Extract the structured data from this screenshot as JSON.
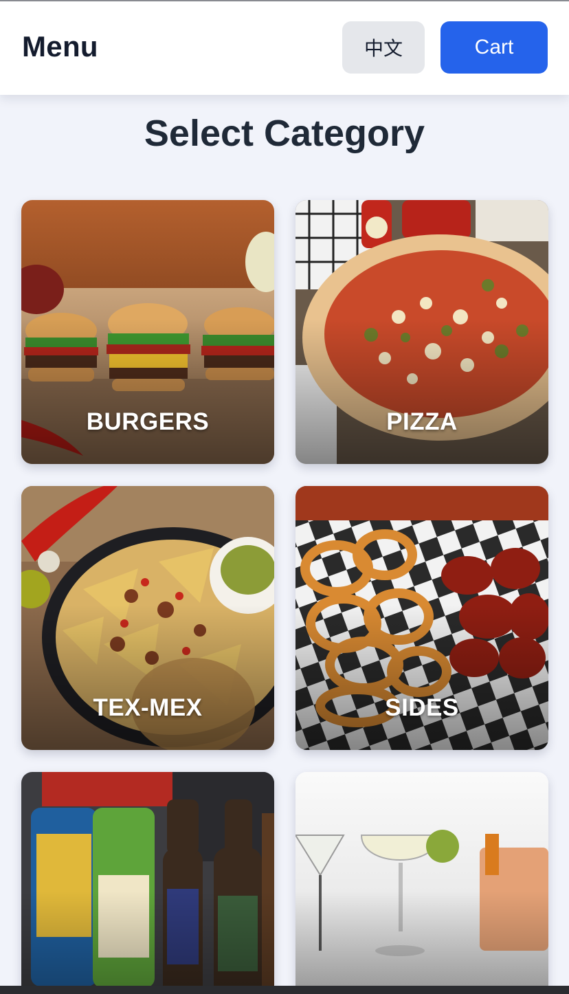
{
  "header": {
    "title": "Menu",
    "language_label": "中文",
    "cart_label": "Cart"
  },
  "main": {
    "heading": "Select Category",
    "categories": [
      {
        "label": "BURGERS",
        "icon": "burger-photo"
      },
      {
        "label": "PIZZA",
        "icon": "pizza-photo"
      },
      {
        "label": "TEX-MEX",
        "icon": "nachos-photo"
      },
      {
        "label": "SIDES",
        "icon": "onion-rings-wings-photo"
      },
      {
        "label": "",
        "icon": "beer-photo"
      },
      {
        "label": "",
        "icon": "cocktails-photo"
      }
    ]
  },
  "colors": {
    "accent": "#2563eb",
    "page_background": "#f1f3fa",
    "title_text": "#141c2e"
  }
}
